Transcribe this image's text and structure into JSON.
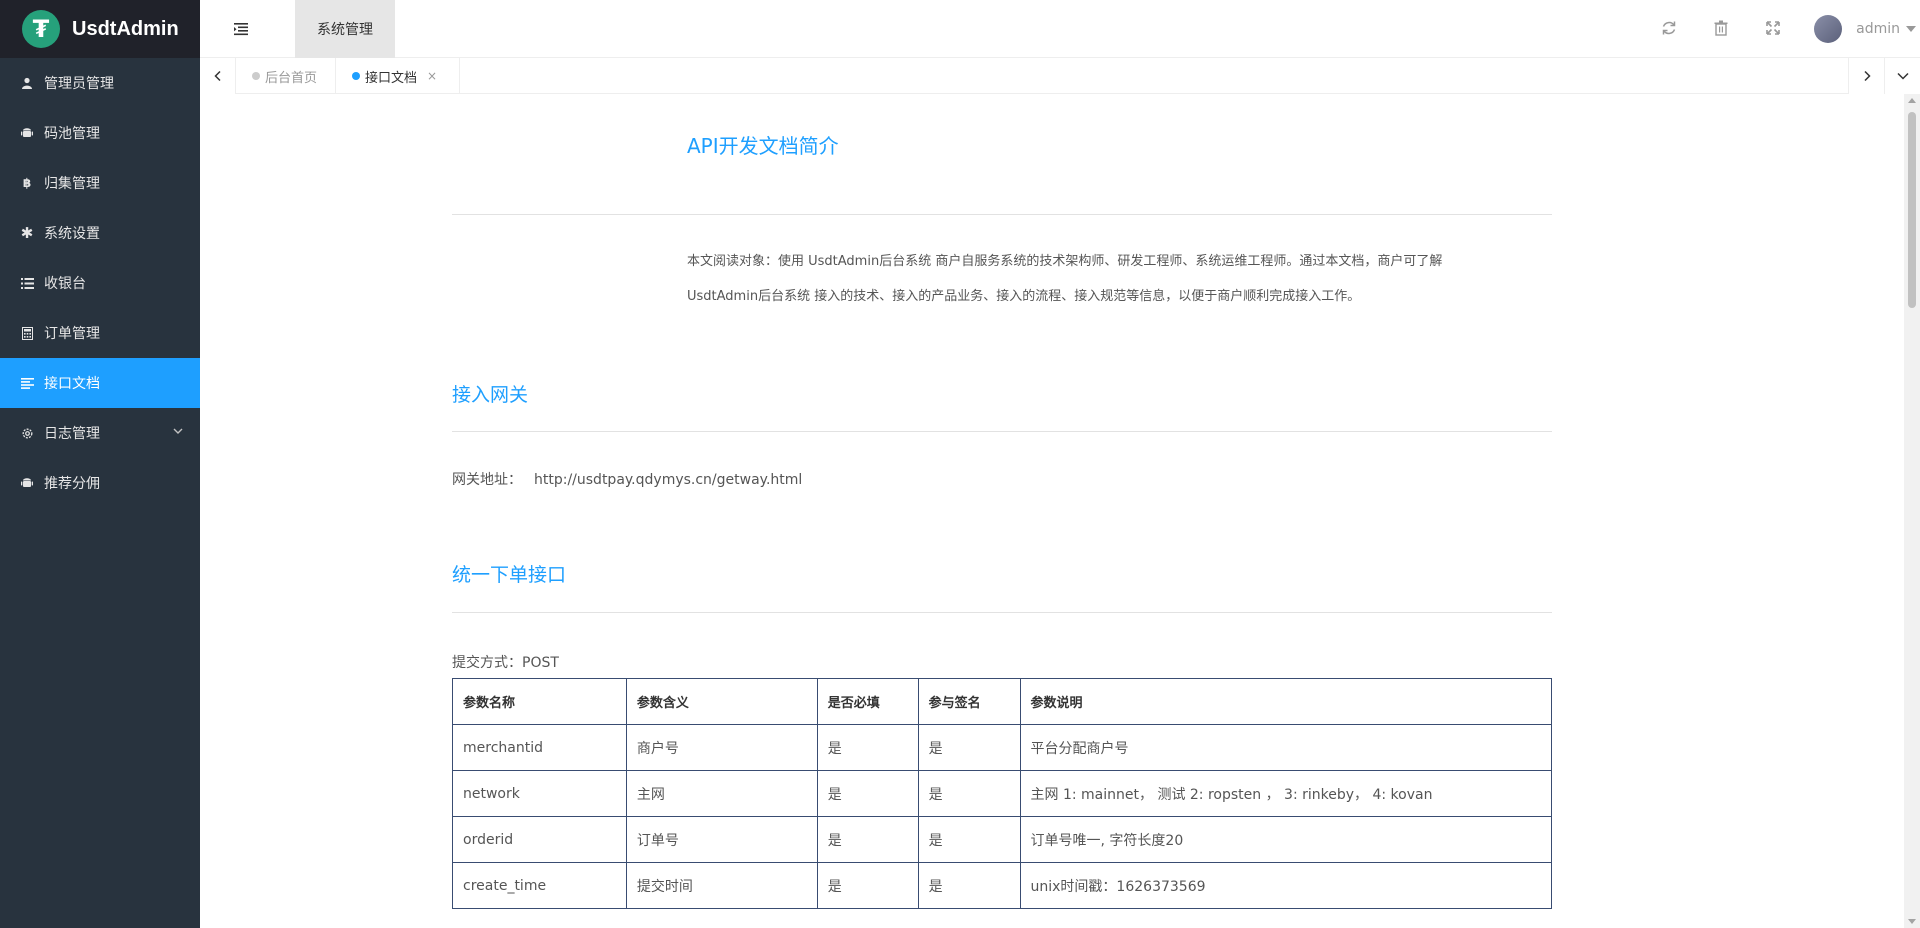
{
  "app": {
    "logo_letter": "₮",
    "title": "UsdtAdmin",
    "brand_color": "#26a17b",
    "accent_color": "#1e9fff"
  },
  "sidebar": {
    "items": [
      {
        "label": "管理员管理",
        "icon": "user-icon"
      },
      {
        "label": "码池管理",
        "icon": "android-icon"
      },
      {
        "label": "归集管理",
        "icon": "bitcoin-icon"
      },
      {
        "label": "系统设置",
        "icon": "asterisk-icon"
      },
      {
        "label": "收银台",
        "icon": "list-icon"
      },
      {
        "label": "订单管理",
        "icon": "calculator-icon"
      },
      {
        "label": "接口文档",
        "icon": "align-left-icon",
        "active": true
      },
      {
        "label": "日志管理",
        "icon": "gear-icon"
      },
      {
        "label": "推荐分佣",
        "icon": "android-icon"
      }
    ]
  },
  "header": {
    "tab_label": "系统管理",
    "user_name": "admin"
  },
  "tabs": {
    "items": [
      {
        "label": "后台首页"
      },
      {
        "label": "接口文档",
        "active": true
      }
    ],
    "close_glyph": "×"
  },
  "doc": {
    "title": "API开发文档简介",
    "intro_line1": "本文阅读对象：使用 UsdtAdmin后台系统 商户自服务系统的技术架构师、研发工程师、系统运维工程师。通过本文档，商户可了解",
    "intro_line2": "UsdtAdmin后台系统 接入的技术、接入的产品业务、接入的流程、接入规范等信息，以便于商户顺利完成接入工作。",
    "gateway_heading": "接入网关",
    "gateway_label": "网关地址：",
    "gateway_url": "http://usdtpay.qdymys.cn/getway.html",
    "order_heading": "统一下单接口",
    "method_label": "提交方式：POST",
    "table": {
      "headers": [
        "参数名称",
        "参数含义",
        "是否必填",
        "参与签名",
        "参数说明"
      ],
      "rows": [
        [
          "merchantid",
          "商户号",
          "是",
          "是",
          "平台分配商户号"
        ],
        [
          "network",
          "主网",
          "是",
          "是",
          "主网 1: mainnet， 测试 2: ropsten ， 3: rinkeby， 4: kovan"
        ],
        [
          "orderid",
          "订单号",
          "是",
          "是",
          "订单号唯一, 字符长度20"
        ],
        [
          "create_time",
          "提交时间",
          "是",
          "是",
          "unix时间戳：1626373569"
        ]
      ]
    }
  }
}
